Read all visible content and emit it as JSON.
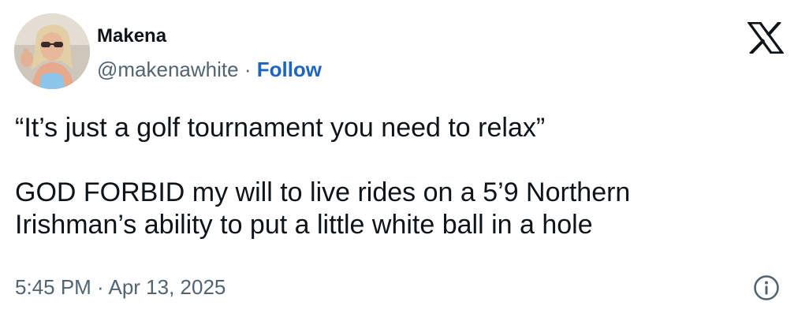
{
  "author": {
    "display_name": "Makena",
    "handle": "@makenawhite",
    "separator": " · ",
    "follow_label": "Follow",
    "avatar_icon": "profile-photo"
  },
  "tweet": {
    "line_1": "“It’s just a golf tournament you need to relax”",
    "line_2": "GOD FORBID my will to live rides on a 5’9 Northern",
    "line_3": "Irishman’s ability to put a little white ball in a hole"
  },
  "meta": {
    "timestamp": "5:45 PM · Apr 13, 2025"
  },
  "icons": {
    "brand": "x-logo-icon",
    "info": "info-icon"
  },
  "colors": {
    "text": "#0f1419",
    "secondary": "#536471",
    "follow": "#1d65c1",
    "background": "#ffffff"
  }
}
